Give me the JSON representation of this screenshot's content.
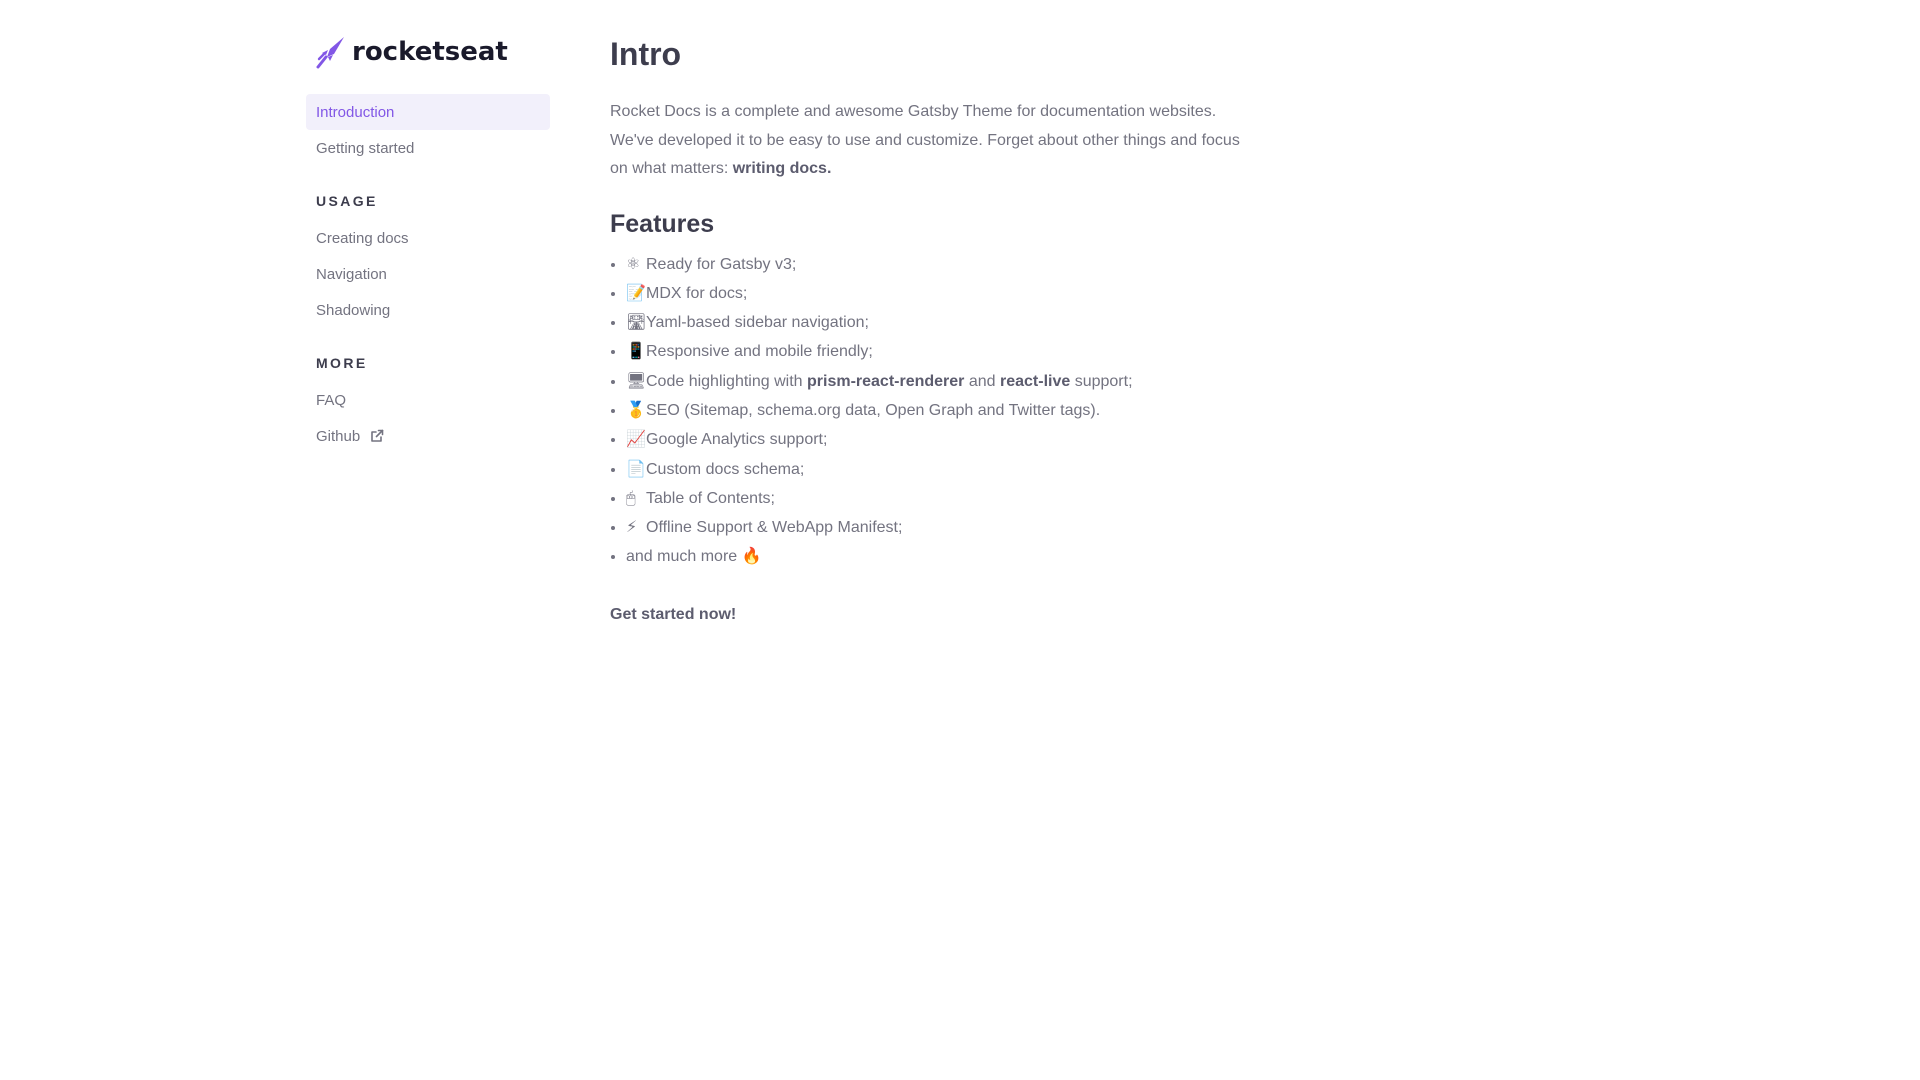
{
  "brand": {
    "name": "rocketseat",
    "accent": "#8257e6"
  },
  "sidebar": {
    "top_items": [
      {
        "label": "Introduction",
        "active": true
      },
      {
        "label": "Getting started",
        "active": false
      }
    ],
    "groups": [
      {
        "title": "USAGE",
        "items": [
          {
            "label": "Creating docs"
          },
          {
            "label": "Navigation"
          },
          {
            "label": "Shadowing"
          }
        ]
      },
      {
        "title": "MORE",
        "items": [
          {
            "label": "FAQ"
          },
          {
            "label": "Github",
            "icon": "external-link-icon"
          }
        ]
      }
    ]
  },
  "main": {
    "title": "Intro",
    "intro_text": "Rocket Docs is a complete and awesome Gatsby Theme for documentation websites. We've developed it to be easy to use and customize. Forget about other things and focus on what matters: ",
    "intro_bold": "writing docs.",
    "features_title": "Features",
    "features": [
      {
        "emoji": "⚛",
        "text": "Ready for Gatsby v3;"
      },
      {
        "emoji": "📝",
        "text": "MDX for docs;"
      },
      {
        "emoji": "🛣",
        "text": "Yaml-based sidebar navigation;"
      },
      {
        "emoji": "📱",
        "text": "Responsive and mobile friendly;"
      },
      {
        "emoji": "🖥",
        "text_before": "Code highlighting with ",
        "bold1": "prism-react-renderer",
        "text_mid": " and ",
        "bold2": "react-live",
        "text_after": " support;"
      },
      {
        "emoji": "🥇",
        "text": "SEO (Sitemap, schema.org data, Open Graph and Twitter tags)."
      },
      {
        "emoji": "📈",
        "text": "Google Analytics support;"
      },
      {
        "emoji": "📄",
        "text": "Custom docs schema;"
      },
      {
        "emoji": "🖱",
        "text": "Table of Contents;"
      },
      {
        "emoji": "⚡",
        "text": "Offline Support & WebApp Manifest;"
      },
      {
        "emoji": "🔥",
        "text": "and much more",
        "emoji_after": true
      }
    ],
    "cta": "Get started now!"
  }
}
